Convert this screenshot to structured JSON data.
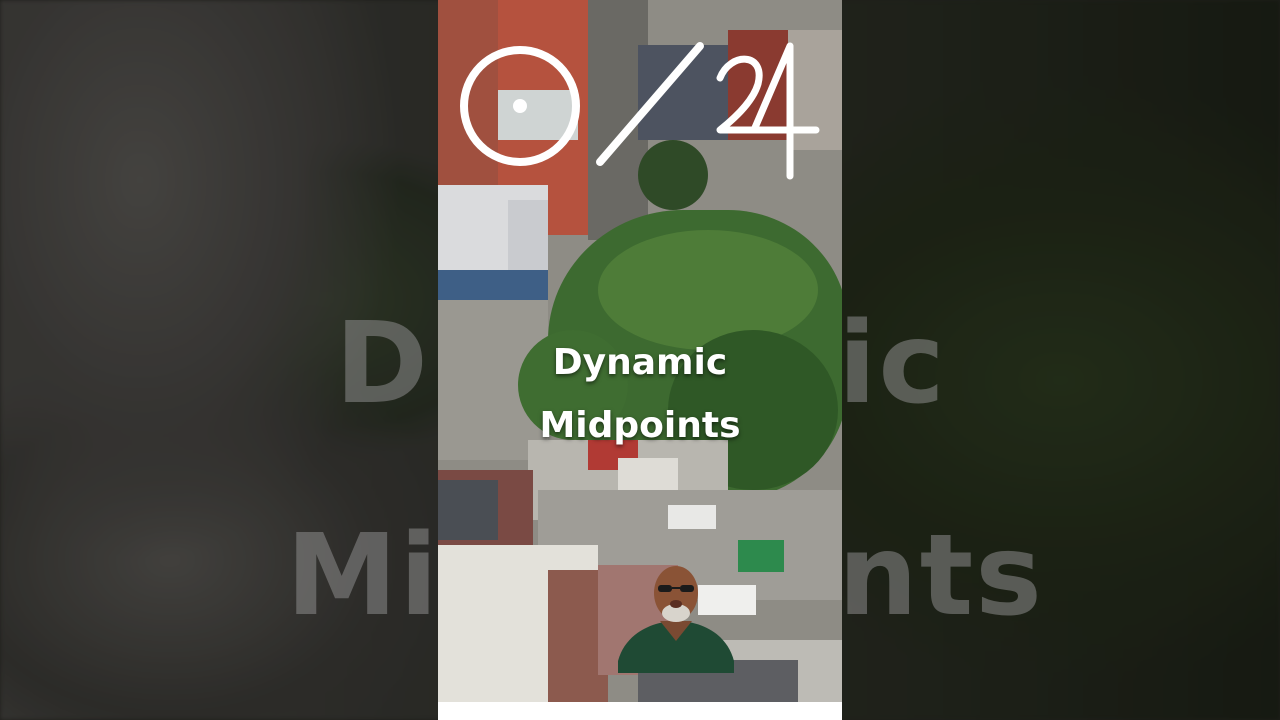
{
  "counter": {
    "current": "0",
    "separator": "/",
    "total": "24"
  },
  "video_title": {
    "line1": "Dynamic",
    "line2": "Midpoints"
  },
  "background_text": {
    "line1_left": "D",
    "line1_right": "ic",
    "line2_left": "Mi",
    "line2_right": "nts"
  },
  "colors": {
    "foliage": "#3c6b2f",
    "brick": "#9a4a3a",
    "road": "#8c8c86",
    "title_text": "#ffffff"
  },
  "presenter": {
    "avatar_icon": "presenter-avatar-icon"
  }
}
